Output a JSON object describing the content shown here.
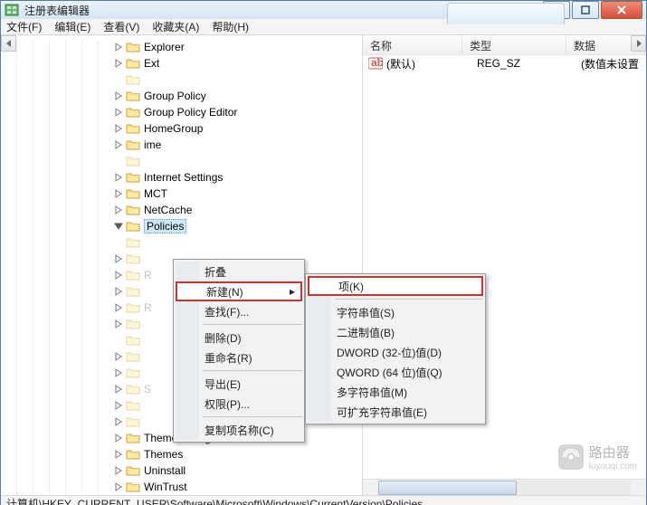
{
  "window": {
    "title": "注册表编辑器"
  },
  "menus": {
    "file": "文件(F)",
    "edit": "编辑(E)",
    "view": "查看(V)",
    "fav": "收藏夹(A)",
    "help": "帮助(H)"
  },
  "tree": {
    "items": [
      {
        "label": "Explorer",
        "tog": "closed"
      },
      {
        "label": "Ext",
        "tog": "closed"
      },
      {
        "label": "",
        "tog": "none",
        "faded": true
      },
      {
        "label": "Group Policy",
        "tog": "closed"
      },
      {
        "label": "Group Policy Editor",
        "tog": "closed"
      },
      {
        "label": "HomeGroup",
        "tog": "closed"
      },
      {
        "label": "ime",
        "tog": "closed"
      },
      {
        "label": "",
        "tog": "none",
        "faded": true
      },
      {
        "label": "Internet Settings",
        "tog": "closed"
      },
      {
        "label": "MCT",
        "tog": "closed"
      },
      {
        "label": "NetCache",
        "tog": "closed"
      },
      {
        "label": "Policies",
        "tog": "open",
        "selected": true
      },
      {
        "label": "",
        "tog": "none",
        "faded": true
      },
      {
        "label": "",
        "tog": "closed",
        "faded": true
      },
      {
        "label": "R",
        "tog": "closed",
        "faded": true
      },
      {
        "label": "",
        "tog": "closed",
        "faded": true
      },
      {
        "label": "R",
        "tog": "closed",
        "faded": true
      },
      {
        "label": "",
        "tog": "closed",
        "faded": true
      },
      {
        "label": "",
        "tog": "none",
        "faded": true
      },
      {
        "label": "",
        "tog": "closed",
        "faded": true
      },
      {
        "label": "",
        "tog": "closed",
        "faded": true
      },
      {
        "label": "S",
        "tog": "closed",
        "faded": true
      },
      {
        "label": "",
        "tog": "closed",
        "faded": true
      },
      {
        "label": "",
        "tog": "closed",
        "faded": true
      },
      {
        "label": "ThemeManager",
        "tog": "closed"
      },
      {
        "label": "Themes",
        "tog": "closed"
      },
      {
        "label": "Uninstall",
        "tog": "closed"
      },
      {
        "label": "WinTrust",
        "tog": "closed"
      }
    ]
  },
  "list": {
    "headers": {
      "name": "名称",
      "type": "类型",
      "data": "数据"
    },
    "rows": [
      {
        "name": "(默认)",
        "type": "REG_SZ",
        "data": "(数值未设置"
      }
    ]
  },
  "ctx1": {
    "collapse": "折叠",
    "new": "新建(N)",
    "find": "查找(F)...",
    "delete": "删除(D)",
    "rename": "重命名(R)",
    "export": "导出(E)",
    "perm": "权限(P)...",
    "copy": "复制项名称(C)"
  },
  "ctx2": {
    "key": "项(K)",
    "sz": "字符串值(S)",
    "bin": "二进制值(B)",
    "dword": "DWORD (32-位)值(D)",
    "qword": "QWORD (64 位)值(Q)",
    "multi": "多字符串值(M)",
    "expand": "可扩充字符串值(E)"
  },
  "status": "计算机\\HKEY_CURRENT_USER\\Software\\Microsoft\\Windows\\CurrentVersion\\Policies",
  "watermark": {
    "text": "路由器",
    "sub": "luyouqi.com"
  }
}
